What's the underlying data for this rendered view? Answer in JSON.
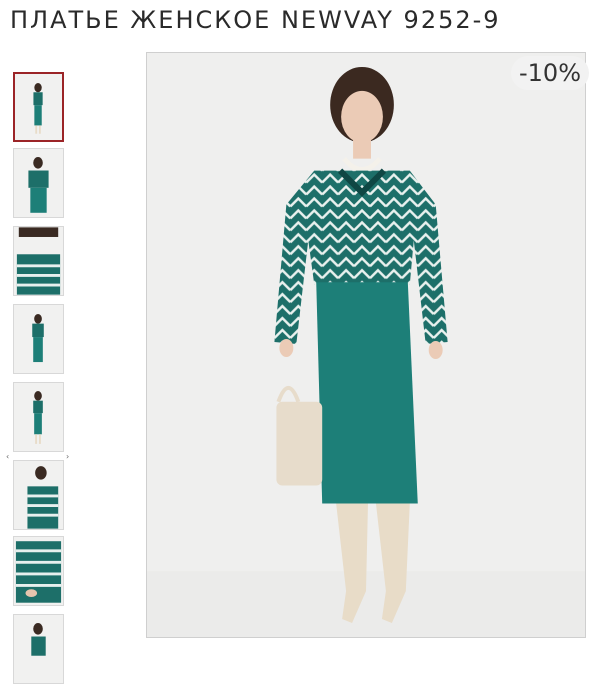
{
  "product": {
    "title": "ПЛАТЬЕ ЖЕНСКОЕ NEWVAY 9252-9",
    "discount_badge": "-10%"
  },
  "colors": {
    "accent_border": "#9b2427",
    "dress": "#1d7f78",
    "stripe": "#134d4a",
    "boots": "#e8dcc8"
  },
  "gallery": {
    "prev_icon": "chevron-left-icon",
    "next_icon": "chevron-right-icon",
    "prev_label": "‹",
    "next_label": "›"
  }
}
